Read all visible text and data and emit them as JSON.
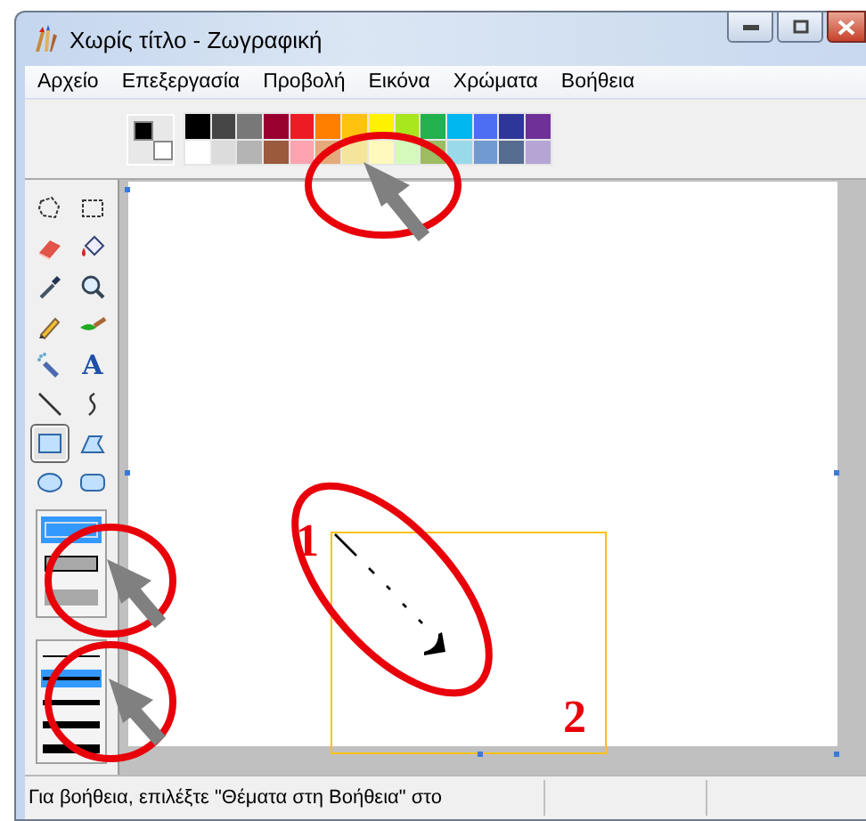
{
  "window": {
    "title": "Χωρίς τίτλο - Ζωγραφική"
  },
  "menu": [
    {
      "label": "Αρχείο"
    },
    {
      "label": "Επεξεργασία"
    },
    {
      "label": "Προβολή"
    },
    {
      "label": "Εικόνα"
    },
    {
      "label": "Χρώματα"
    },
    {
      "label": "Βοήθεια"
    }
  ],
  "current_colors": {
    "foreground": {
      "color": "#000000"
    },
    "background": {
      "color": "#ffffff"
    }
  },
  "palette": [
    {
      "color": "#000000"
    },
    {
      "color": "#464646"
    },
    {
      "color": "#787878"
    },
    {
      "color": "#990030"
    },
    {
      "color": "#ed1c24"
    },
    {
      "color": "#ff7e00"
    },
    {
      "color": "#ffc20e"
    },
    {
      "color": "#fff200"
    },
    {
      "color": "#a8e61d"
    },
    {
      "color": "#22b14c"
    },
    {
      "color": "#00b7ef"
    },
    {
      "color": "#4d6df3"
    },
    {
      "color": "#2f3699"
    },
    {
      "color": "#6f3198"
    },
    {
      "color": "#ffffff"
    },
    {
      "color": "#dcdcdc"
    },
    {
      "color": "#b4b4b4"
    },
    {
      "color": "#9c5a3c"
    },
    {
      "color": "#ffa3b1"
    },
    {
      "color": "#e5aa7a"
    },
    {
      "color": "#f5e49c"
    },
    {
      "color": "#fff9bd"
    },
    {
      "color": "#d3f9bc"
    },
    {
      "color": "#9dbb61"
    },
    {
      "color": "#99d9ea"
    },
    {
      "color": "#709ad1"
    },
    {
      "color": "#546d8e"
    },
    {
      "color": "#b5a5d5"
    }
  ],
  "tools": [
    {
      "selected": false
    },
    {
      "selected": false
    },
    {
      "selected": false
    },
    {
      "selected": false
    },
    {
      "selected": false
    },
    {
      "selected": false
    },
    {
      "selected": false
    },
    {
      "selected": false
    },
    {
      "selected": false
    },
    {
      "selected": false,
      "glyph": "A"
    },
    {
      "selected": false
    },
    {
      "selected": false
    },
    {
      "selected": true
    },
    {
      "selected": false
    },
    {
      "selected": false
    },
    {
      "selected": false
    }
  ],
  "fill_styles": [
    {
      "selected": true
    },
    {
      "selected": false
    },
    {
      "selected": false
    }
  ],
  "line_widths": [
    {
      "selected": false
    },
    {
      "selected": true
    },
    {
      "selected": false
    },
    {
      "selected": false
    },
    {
      "selected": false
    }
  ],
  "callouts": [
    {
      "label": "1"
    },
    {
      "label": "2"
    }
  ],
  "status_bar": {
    "text": "Για βοήθεια, επιλέξτε \"Θέματα στη Βοήθεια\" στο"
  }
}
